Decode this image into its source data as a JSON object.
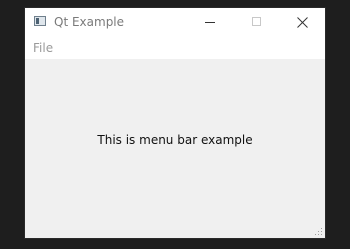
{
  "window": {
    "title": "Qt Example",
    "icon": "qt-app-icon",
    "controls": {
      "minimize_icon": "minimize-icon",
      "maximize_icon": "maximize-icon",
      "close_icon": "close-icon"
    }
  },
  "menubar": {
    "items": [
      {
        "label": "File"
      }
    ]
  },
  "central": {
    "label": "This is menu bar example"
  },
  "colors": {
    "titlebar_bg": "#ffffff",
    "client_bg": "#f0f0f0",
    "desktop_bg": "#1e1e1e",
    "title_text": "#7a7a7a",
    "menu_text": "#9a9a9a",
    "body_text": "#111111"
  }
}
